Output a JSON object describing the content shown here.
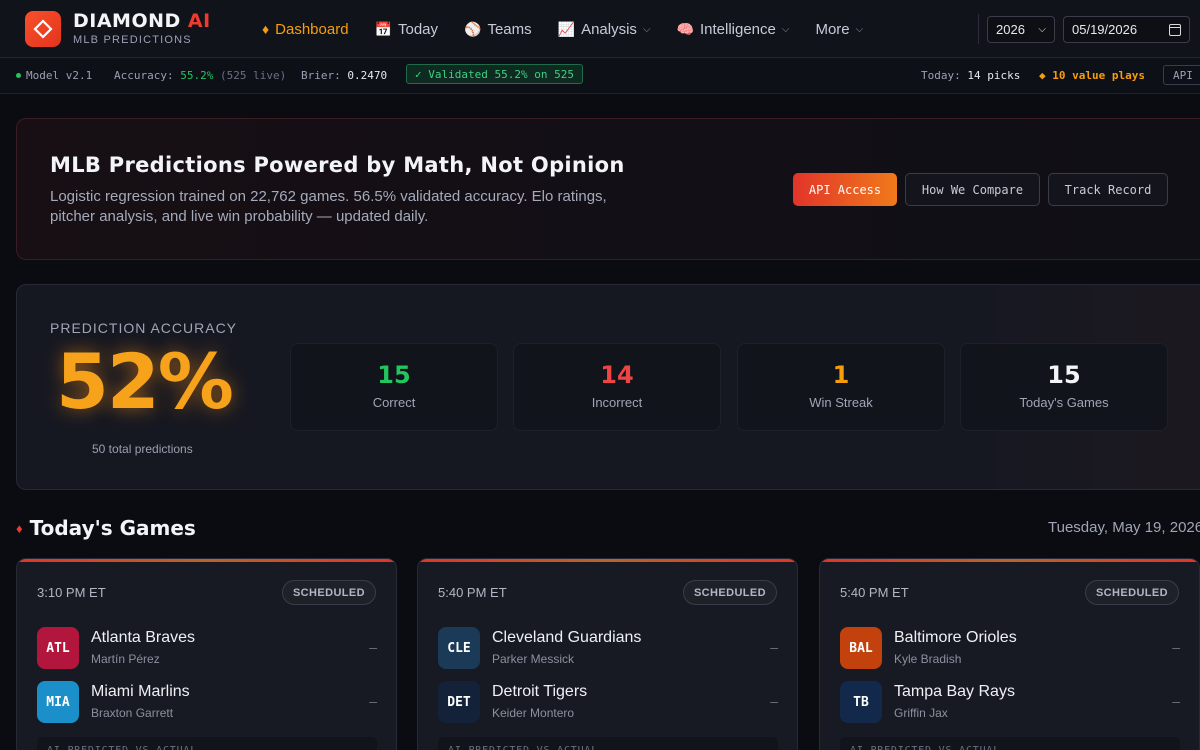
{
  "brand": {
    "name": "DIAMOND",
    "name_accent": "AI",
    "subtitle": "MLB PREDICTIONS"
  },
  "nav": [
    {
      "label": "Dashboard",
      "icon": "♦",
      "active": true
    },
    {
      "label": "Today",
      "icon": "📅"
    },
    {
      "label": "Teams",
      "icon": "⚾"
    },
    {
      "label": "Analysis",
      "icon": "📈",
      "dropdown": true
    },
    {
      "label": "Intelligence",
      "icon": "🧠",
      "dropdown": true
    },
    {
      "label": "More",
      "dropdown": true
    }
  ],
  "controls": {
    "year": "2026",
    "date": "05/19/2026"
  },
  "status": {
    "model": "Model v2.1",
    "accuracy_label": "Accuracy:",
    "accuracy_value": "55.2%",
    "accuracy_live": "(525 live)",
    "brier_label": "Brier:",
    "brier_value": "0.2470",
    "validated": "✓ Validated 55.2% on 525",
    "today_label": "Today:",
    "today_value": "14 picks",
    "value_plays": "◆ 10 value plays",
    "api": "API"
  },
  "hero": {
    "title": "MLB Predictions Powered by Math, Not Opinion",
    "description": "Logistic regression trained on 22,762 games. 56.5% validated accuracy. Elo ratings, pitcher analysis, and live win probability — updated daily.",
    "buttons": {
      "api": "API Access",
      "compare": "How We Compare",
      "track": "Track Record"
    }
  },
  "accuracy": {
    "label": "PREDICTION ACCURACY",
    "value": "52%",
    "total": "50 total predictions",
    "stats": [
      {
        "value": "15",
        "label": "Correct",
        "color": "#22c55e"
      },
      {
        "value": "14",
        "label": "Incorrect",
        "color": "#ef4444"
      },
      {
        "value": "1",
        "label": "Win Streak",
        "color": "#f59e0b"
      },
      {
        "value": "15",
        "label": "Today's Games",
        "color": "#f3f4f8"
      }
    ]
  },
  "games": {
    "title": "Today's Games",
    "date": "Tuesday, May 19, 2026",
    "footer_label": "AI PREDICTED VS ACTUAL",
    "cards": [
      {
        "time": "3:10 PM ET",
        "status": "SCHEDULED",
        "teams": [
          {
            "abbr": "ATL",
            "name": "Atlanta Braves",
            "pitcher": "Martín Pérez",
            "score": "–",
            "color": "#b3163c"
          },
          {
            "abbr": "MIA",
            "name": "Miami Marlins",
            "pitcher": "Braxton Garrett",
            "score": "–",
            "color": "#1a8fc9"
          }
        ]
      },
      {
        "time": "5:40 PM ET",
        "status": "SCHEDULED",
        "teams": [
          {
            "abbr": "CLE",
            "name": "Cleveland Guardians",
            "pitcher": "Parker Messick",
            "score": "–",
            "color": "#1b3a57"
          },
          {
            "abbr": "DET",
            "name": "Detroit Tigers",
            "pitcher": "Keider Montero",
            "score": "–",
            "color": "#132238"
          }
        ]
      },
      {
        "time": "5:40 PM ET",
        "status": "SCHEDULED",
        "teams": [
          {
            "abbr": "BAL",
            "name": "Baltimore Orioles",
            "pitcher": "Kyle Bradish",
            "score": "–",
            "color": "#c2410c"
          },
          {
            "abbr": "TB",
            "name": "Tampa Bay Rays",
            "pitcher": "Griffin Jax",
            "score": "–",
            "color": "#13294b"
          }
        ]
      }
    ]
  }
}
